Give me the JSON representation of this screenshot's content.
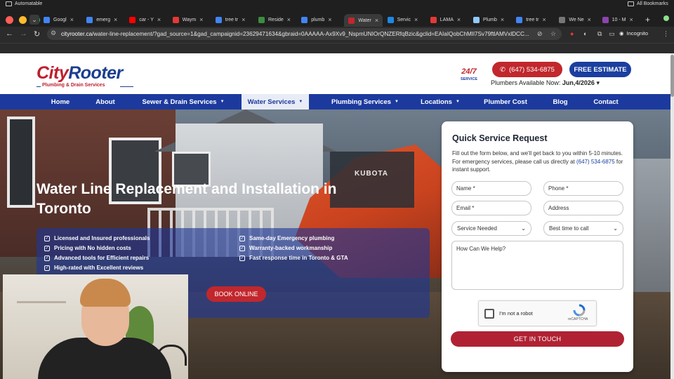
{
  "browser": {
    "tabs": [
      {
        "label": "Googl",
        "color": "#4285f4"
      },
      {
        "label": "emerg",
        "color": "#4285f4"
      },
      {
        "label": "car - Y",
        "color": "#ff0000"
      },
      {
        "label": "Waym",
        "color": "#e53935"
      },
      {
        "label": "tree tr",
        "color": "#4285f4"
      },
      {
        "label": "Reside",
        "color": "#3c8d40"
      },
      {
        "label": "plumb",
        "color": "#4285f4"
      },
      {
        "label": "Water",
        "color": "#c1272d"
      },
      {
        "label": "Servic",
        "color": "#1e88e5"
      },
      {
        "label": "LAMA",
        "color": "#e53935"
      },
      {
        "label": "Plumb",
        "color": "#90caf9"
      },
      {
        "label": "tree tr",
        "color": "#4285f4"
      },
      {
        "label": "We Ne",
        "color": "#777777"
      },
      {
        "label": "10 - M",
        "color": "#8e44ad"
      }
    ],
    "active_tab": 7,
    "url_domain": "cityrooter.ca",
    "url_path": "/water-line-replacement/?gad_source=1&gad_campaignid=23629471634&gbraid=0AAAAA-Ax9Xv9_NspmUNIOrQNZERfqBzic&gclid=EAIaIQobChMIl7Sv79ftlAMVxlDCC...",
    "incognito_label": "Incognito",
    "bookmark_folder": "Automatable",
    "all_bookmarks": "All Bookmarks"
  },
  "site": {
    "logo_city": "City",
    "logo_rooter": "Rooter",
    "logo_tagline": "Plumbing & Drain Services",
    "badge_247": "24/7",
    "badge_service": "SERVICE",
    "phone": "(647) 534-6875",
    "estimate": "FREE ESTIMATE",
    "availability_label": "Plumbers Available Now:",
    "availability_date": "Jun,4/2026"
  },
  "nav": [
    {
      "label": "Home",
      "dropdown": false
    },
    {
      "label": "About",
      "dropdown": false
    },
    {
      "label": "Sewer & Drain Services",
      "dropdown": true
    },
    {
      "label": "Water Services",
      "dropdown": true,
      "active": true
    },
    {
      "label": "Plumbing Services",
      "dropdown": true
    },
    {
      "label": "Locations",
      "dropdown": true
    },
    {
      "label": "Plumber Cost",
      "dropdown": false
    },
    {
      "label": "Blog",
      "dropdown": false
    },
    {
      "label": "Contact",
      "dropdown": false
    }
  ],
  "hero": {
    "title_line1": "Water Line Replacement and Installation in",
    "title_line2": "Toronto",
    "kubota": "KUBOTA",
    "features_left": [
      "Licensed and Insured professionals",
      "Pricing with No hidden costs",
      "Advanced tools for Efficient repairs",
      "High-rated with Excellent reviews"
    ],
    "features_right": [
      "Same-day Emergency plumbing",
      "Warranty-backed workmanship",
      "Fast response time in Toronto & GTA"
    ],
    "book_online": "BOOK ONLINE"
  },
  "form": {
    "title": "Quick Service Request",
    "desc_part1": "Fill out the form below, and we'll get back to you within 5-10 minutes. For emergency services, please call us directly at ",
    "desc_phone": "(647) 534-6875",
    "desc_part2": " for instant support.",
    "name_placeholder": "Name *",
    "phone_placeholder": "Phone *",
    "email_placeholder": "Email *",
    "address_placeholder": "Address",
    "service_select": "Service Needed",
    "time_select": "Best time to call",
    "message_placeholder": "How Can We Help?",
    "captcha_text": "I'm not a robot",
    "captcha_brand": "reCAPTCHA",
    "submit": "GET IN TOUCH"
  },
  "colors": {
    "brand_red": "#c1272d",
    "brand_blue": "#1c3a9e",
    "submit_red": "#b02233"
  }
}
